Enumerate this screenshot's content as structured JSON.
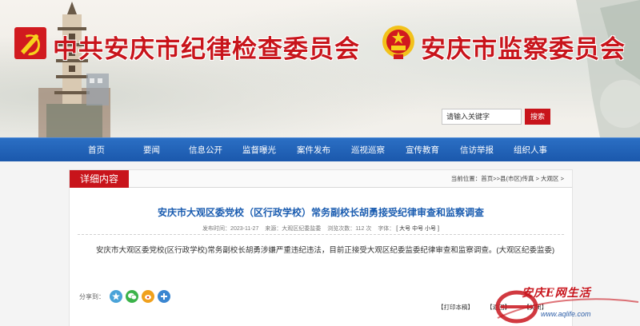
{
  "header": {
    "org_left": "中共安庆市纪律检查委员会",
    "org_right": "安庆市监察委员会",
    "search_placeholder": "请输入关键字",
    "search_button": "搜索"
  },
  "nav": {
    "items": [
      "首页",
      "要闻",
      "信息公开",
      "监督曝光",
      "案件发布",
      "巡视巡察",
      "宣传教育",
      "信访举报",
      "组织人事"
    ]
  },
  "section": {
    "tab": "详细内容",
    "breadcrumb": "当前位置：首页>>县(市区)传真 > 大观区 >"
  },
  "article": {
    "title": "安庆市大观区委党校（区行政学校）常务副校长胡勇接受纪律审查和监察调查",
    "published": "发布时间：2023-11-27",
    "source": "来源：大观区纪委监委",
    "views": "浏览次数：112 次",
    "font_label": "字体：",
    "font_options": "[ 大号 中号 小号 ]",
    "body": "安庆市大观区委党校(区行政学校)常务副校长胡勇涉嫌严重违纪违法，目前正接受大观区纪委监委纪律审查和监察调查。(大观区纪委监委)"
  },
  "share": {
    "label": "分享到：",
    "icons": [
      "qzone-icon",
      "wechat-icon",
      "weibo-icon",
      "more-icon"
    ]
  },
  "footer_links": [
    "【打印本稿】",
    "【返回】",
    "【关闭】"
  ],
  "watermark": {
    "text": "安庆E网生活",
    "url": "www.aqlife.com"
  },
  "colors": {
    "brand_red": "#c8141b",
    "nav_blue": "#1b58ac",
    "title_blue": "#1a5cb0"
  }
}
